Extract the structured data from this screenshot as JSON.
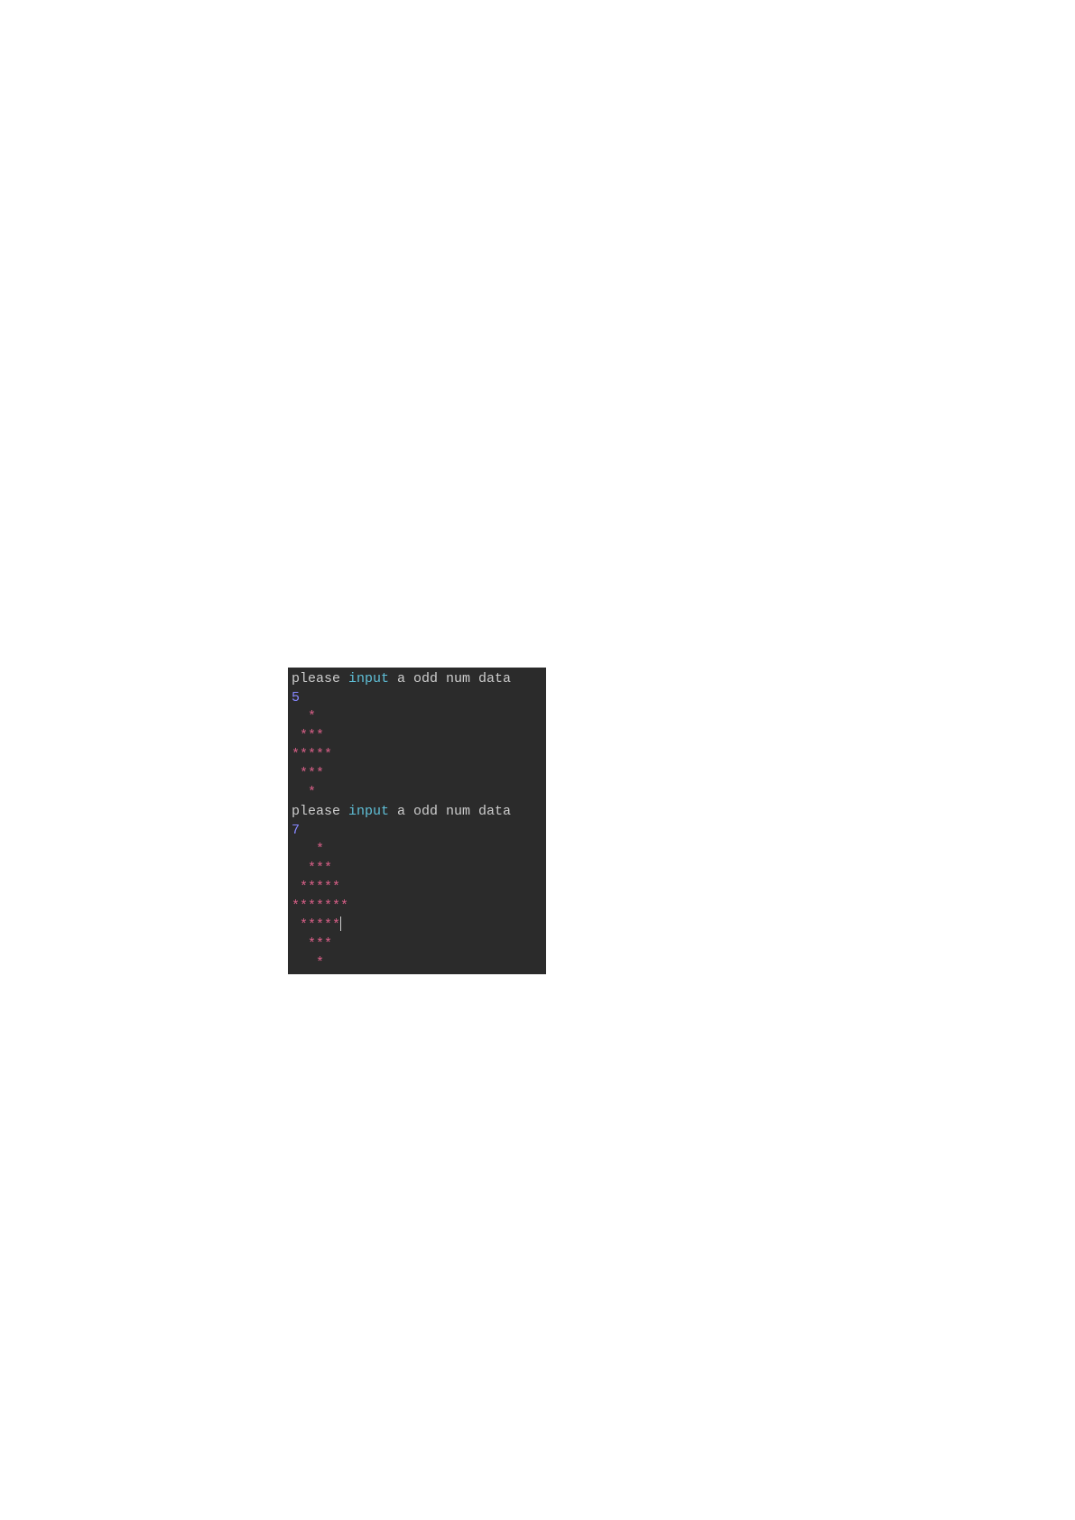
{
  "terminal": {
    "lines": [
      {
        "segments": [
          {
            "text": "please ",
            "class": "prompt-text"
          },
          {
            "text": "input",
            "class": "keyword"
          },
          {
            "text": " a odd num data",
            "class": "prompt-text"
          }
        ]
      },
      {
        "segments": [
          {
            "text": "5",
            "class": "number"
          }
        ]
      },
      {
        "segments": [
          {
            "text": "  *",
            "class": "stars"
          }
        ]
      },
      {
        "segments": [
          {
            "text": " ***",
            "class": "stars"
          }
        ]
      },
      {
        "segments": [
          {
            "text": "*****",
            "class": "stars"
          }
        ]
      },
      {
        "segments": [
          {
            "text": " ***",
            "class": "stars"
          }
        ]
      },
      {
        "segments": [
          {
            "text": "  *",
            "class": "stars"
          }
        ]
      },
      {
        "segments": [
          {
            "text": "please ",
            "class": "prompt-text"
          },
          {
            "text": "input",
            "class": "keyword"
          },
          {
            "text": " a odd num data",
            "class": "prompt-text"
          }
        ]
      },
      {
        "segments": [
          {
            "text": "7",
            "class": "number"
          }
        ]
      },
      {
        "segments": [
          {
            "text": "   *",
            "class": "stars"
          }
        ]
      },
      {
        "segments": [
          {
            "text": "  ***",
            "class": "stars"
          }
        ]
      },
      {
        "segments": [
          {
            "text": " *****",
            "class": "stars"
          }
        ]
      },
      {
        "segments": [
          {
            "text": "*******",
            "class": "stars"
          }
        ]
      },
      {
        "segments": [
          {
            "text": " *****",
            "class": "stars"
          }
        ],
        "cursor": true
      },
      {
        "segments": [
          {
            "text": "  ***",
            "class": "stars"
          }
        ]
      },
      {
        "segments": [
          {
            "text": "   *",
            "class": "stars"
          }
        ]
      }
    ]
  }
}
